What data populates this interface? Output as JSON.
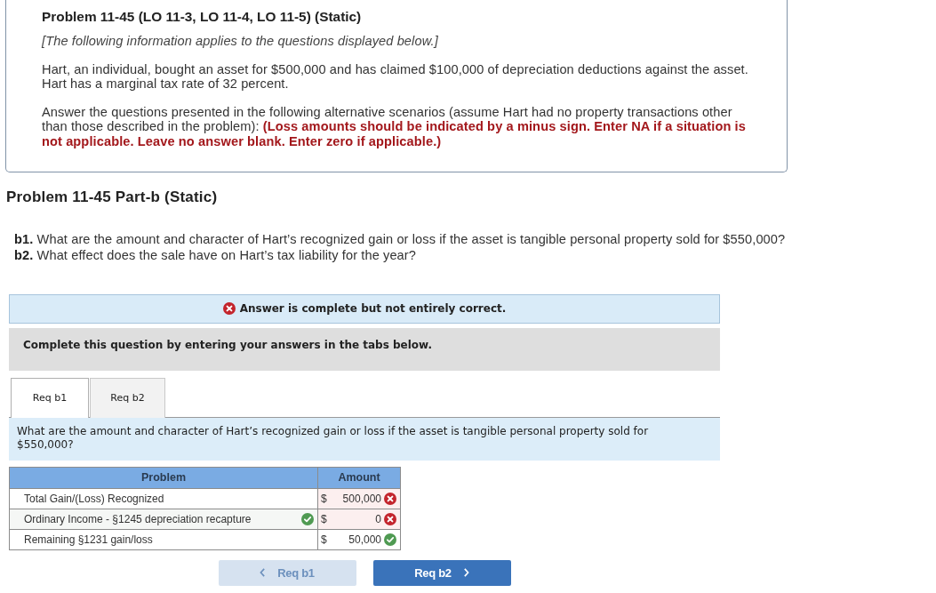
{
  "intro": {
    "title": "Problem 11-45 (LO 11-3, LO 11-4, LO 11-5) (Static)",
    "note": "[The following information applies to the questions displayed below.]",
    "paragraphs": [
      "Hart, an individual, bought an asset for $500,000 and has claimed $100,000 of depreciation deductions against the asset. Hart has a marginal tax rate of 32 percent.",
      "Answer the questions presented in the following alternative scenarios (assume Hart had no property transactions other than those described in the problem): **(Loss amounts should be indicated by a minus sign. Enter NA if a situation is not applicable. Leave no answer blank. Enter zero if applicable.)**"
    ]
  },
  "part": {
    "title": "Problem 11-45 Part-b (Static)",
    "questions": [
      "**b1.** What are the amount and character of Hart’s recognized gain or loss if the asset is tangible personal property sold for $550,000?",
      "**b2.** What effect does the sale have on Hart’s tax liability for the year?"
    ]
  },
  "result_banner": {
    "correct": false,
    "text": "Answer is complete but not entirely correct."
  },
  "instruction": "Complete this question by entering your answers in the tabs below.",
  "tabs": [
    {
      "label": "Req b1",
      "selected": true
    },
    {
      "label": "Req b2",
      "selected": false
    }
  ],
  "question": "What are the amount and character of Hart’s recognized gain or loss if the asset is tangible personal property sold for $550,000?",
  "table": {
    "columns": [
      "Problem",
      "Amount"
    ],
    "rows": [
      {
        "label": "Total Gain/(Loss) Recognized",
        "label_correct": false,
        "currency": "$",
        "value": "500,000",
        "correct": false
      },
      {
        "label": "Ordinary Income - §1245 depreciation recapture",
        "label_correct": true,
        "currency": "$",
        "value": "0",
        "correct": false
      },
      {
        "label": "Remaining §1231 gain/loss",
        "label_correct": false,
        "currency": "$",
        "value": "50,000",
        "correct": true
      }
    ]
  },
  "nav": [
    {
      "kind": "prev",
      "label": "Req b1",
      "disabled": true
    },
    {
      "kind": "next",
      "label": "Req b2",
      "disabled": false
    }
  ]
}
